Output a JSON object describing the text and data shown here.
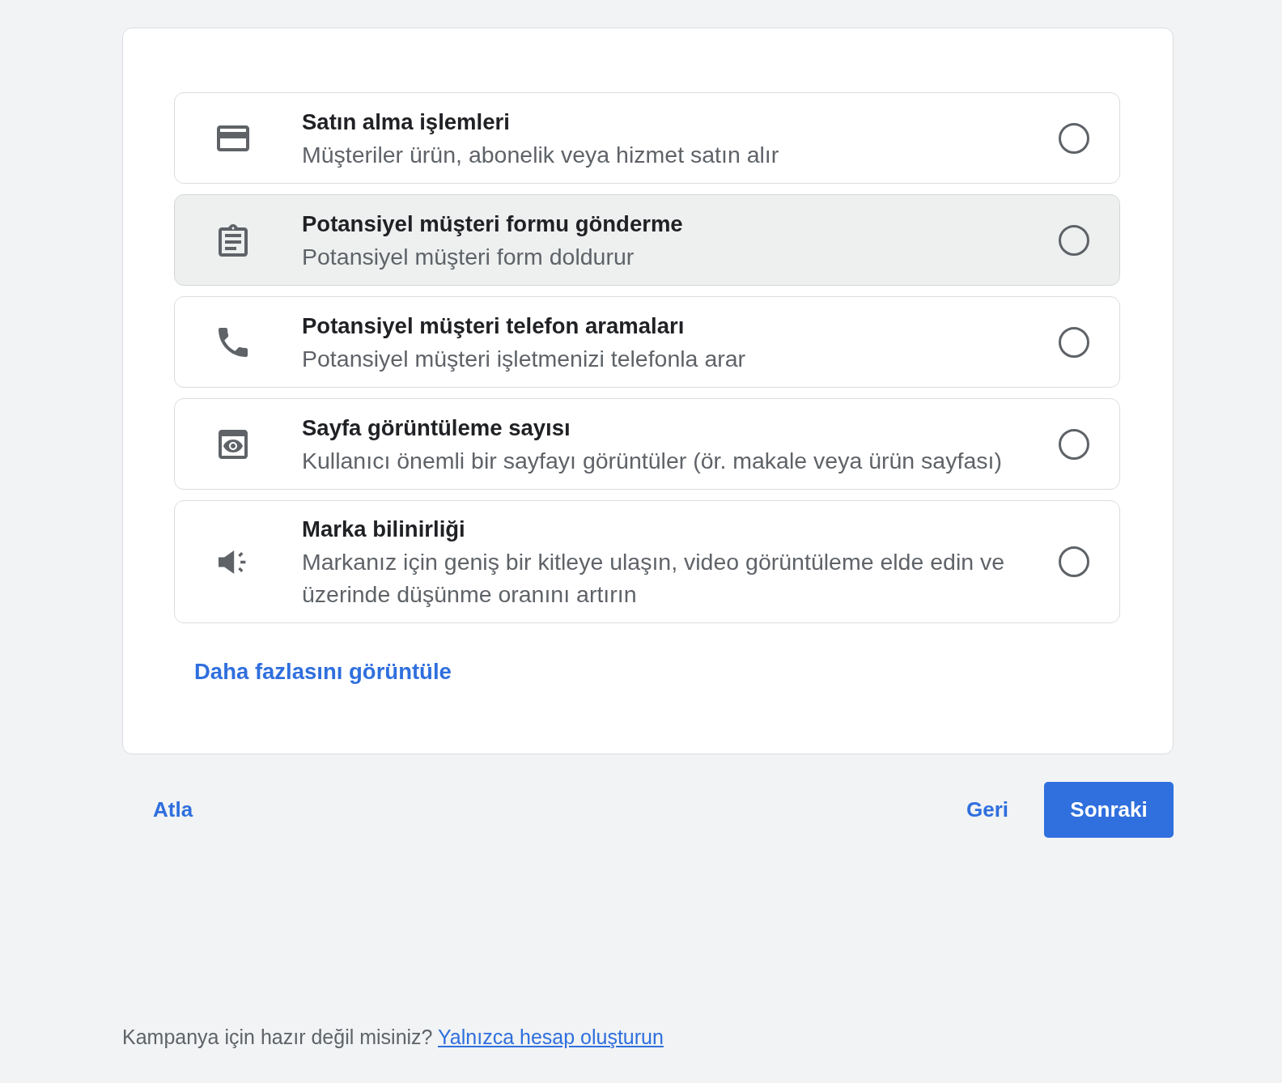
{
  "options": [
    {
      "kind": "card",
      "title": "Satın alma işlemleri",
      "description": "Müşteriler ürün, abonelik veya hizmet satın alır",
      "highlighted": false,
      "selected": false
    },
    {
      "kind": "form",
      "title": "Potansiyel müşteri formu gönderme",
      "description": "Potansiyel müşteri form doldurur",
      "highlighted": true,
      "selected": false
    },
    {
      "kind": "phone",
      "title": "Potansiyel müşteri telefon aramaları",
      "description": "Potansiyel müşteri işletmenizi telefonla arar",
      "highlighted": false,
      "selected": false
    },
    {
      "kind": "pageview",
      "title": "Sayfa görüntüleme sayısı",
      "description": "Kullanıcı önemli bir sayfayı görüntüler (ör. makale veya ürün sayfası)",
      "highlighted": false,
      "selected": false
    },
    {
      "kind": "awareness",
      "title": "Marka bilinirliği",
      "description": "Markanız için geniş bir kitleye ulaşın, video görüntüleme elde edin ve üzerinde düşünme oranını artırın",
      "highlighted": false,
      "selected": false
    }
  ],
  "more_link": "Daha fazlasını görüntüle",
  "footer_buttons": {
    "skip": "Atla",
    "back": "Geri",
    "next": "Sonraki"
  },
  "footer_note": {
    "text": "Kampanya için hazır değil misiniz?",
    "link": "Yalnızca hesap oluşturun"
  }
}
